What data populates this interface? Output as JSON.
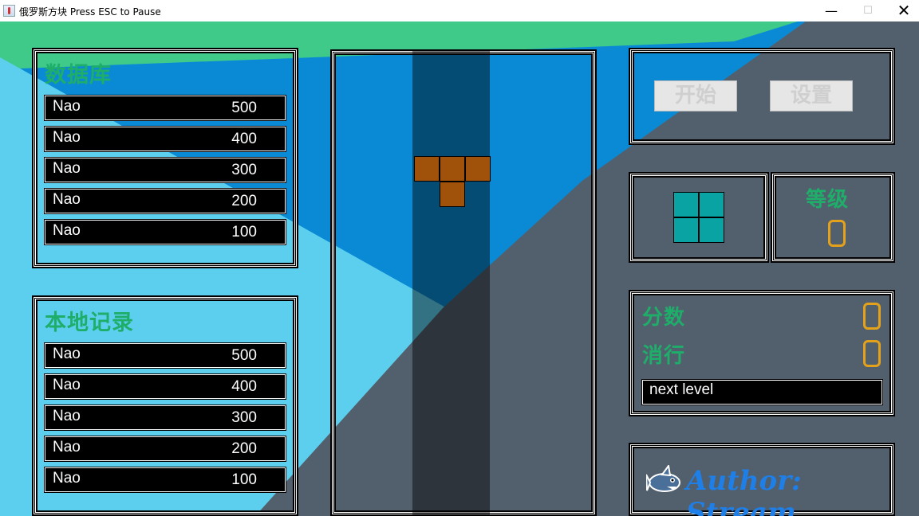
{
  "window": {
    "title": "俄罗斯方块 Press ESC to Pause",
    "minimize": "—",
    "maximize": "☐",
    "close": "✕"
  },
  "database": {
    "heading": "数据库",
    "rows": [
      {
        "name": "Nao",
        "score": "500"
      },
      {
        "name": "Nao",
        "score": "400"
      },
      {
        "name": "Nao",
        "score": "300"
      },
      {
        "name": "Nao",
        "score": "200"
      },
      {
        "name": "Nao",
        "score": "100"
      }
    ]
  },
  "local_records": {
    "heading": "本地记录",
    "rows": [
      {
        "name": "Nao",
        "score": "500"
      },
      {
        "name": "Nao",
        "score": "400"
      },
      {
        "name": "Nao",
        "score": "300"
      },
      {
        "name": "Nao",
        "score": "200"
      },
      {
        "name": "Nao",
        "score": "100"
      }
    ]
  },
  "board": {
    "falling_piece": "T",
    "piece_color": "#a0520a"
  },
  "controls": {
    "start_label": "开始",
    "settings_label": "设置"
  },
  "next_piece": {
    "shape": "O",
    "color": "#0aa3a3"
  },
  "level": {
    "label": "等级",
    "value": "0"
  },
  "stats": {
    "score_label": "分数",
    "score_value": "0",
    "lines_label": "消行",
    "lines_value": "0",
    "next_level_text": "next level"
  },
  "author": {
    "text": "Author: Stream",
    "icon": "shark-icon"
  },
  "colors": {
    "heading_green": "#1fae6a",
    "digit_orange": "#e3a21a",
    "author_blue": "#1e7fe8"
  }
}
